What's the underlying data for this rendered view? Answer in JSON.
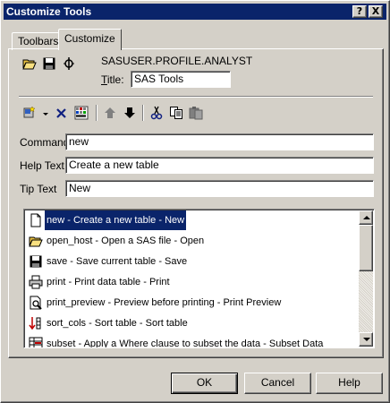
{
  "window": {
    "title": "Customize Tools",
    "help_button": "?",
    "close_button": "X"
  },
  "tabs": [
    {
      "label": "Toolbars",
      "active": false
    },
    {
      "label": "Customize",
      "active": true
    }
  ],
  "profile": {
    "name": "SASUSER.PROFILE.ANALYST",
    "title_label_accel": "T",
    "title_label_rest": "itle:",
    "title_value": "SAS Tools"
  },
  "toolbar_icons": [
    "open-icon",
    "save-icon",
    "mount-icon",
    "add-tool-icon",
    "dropdown-arrow-icon",
    "delete-icon",
    "icon-editor-icon",
    "move-up-icon",
    "move-down-icon",
    "cut-icon",
    "copy-icon",
    "paste-icon"
  ],
  "fields": {
    "command": {
      "label": "Command",
      "value": "new"
    },
    "help_text": {
      "label": "Help Text",
      "value": "Create a new table"
    },
    "tip_text": {
      "label": "Tip Text",
      "value": "New"
    }
  },
  "tools": [
    {
      "text": "new - Create a new table - New",
      "icon": "new-document-icon",
      "selected": true
    },
    {
      "text": "open_host - Open a SAS file - Open",
      "icon": "open-folder-icon",
      "selected": false
    },
    {
      "text": "save - Save current table - Save",
      "icon": "floppy-save-icon",
      "selected": false
    },
    {
      "text": "print - Print data table - Print",
      "icon": "printer-icon",
      "selected": false
    },
    {
      "text": "print_preview - Preview before printing - Print Preview",
      "icon": "print-preview-icon",
      "selected": false
    },
    {
      "text": "sort_cols - Sort table - Sort table",
      "icon": "sort-icon",
      "selected": false
    },
    {
      "text": "subset - Apply a Where clause to subset the data - Subset Data",
      "icon": "subset-icon",
      "selected": false
    }
  ],
  "buttons": {
    "ok": "OK",
    "cancel": "Cancel",
    "help": "Help"
  },
  "colors": {
    "titlebar": "#0a246a",
    "selection": "#0a246a",
    "face": "#d4d0c8"
  }
}
